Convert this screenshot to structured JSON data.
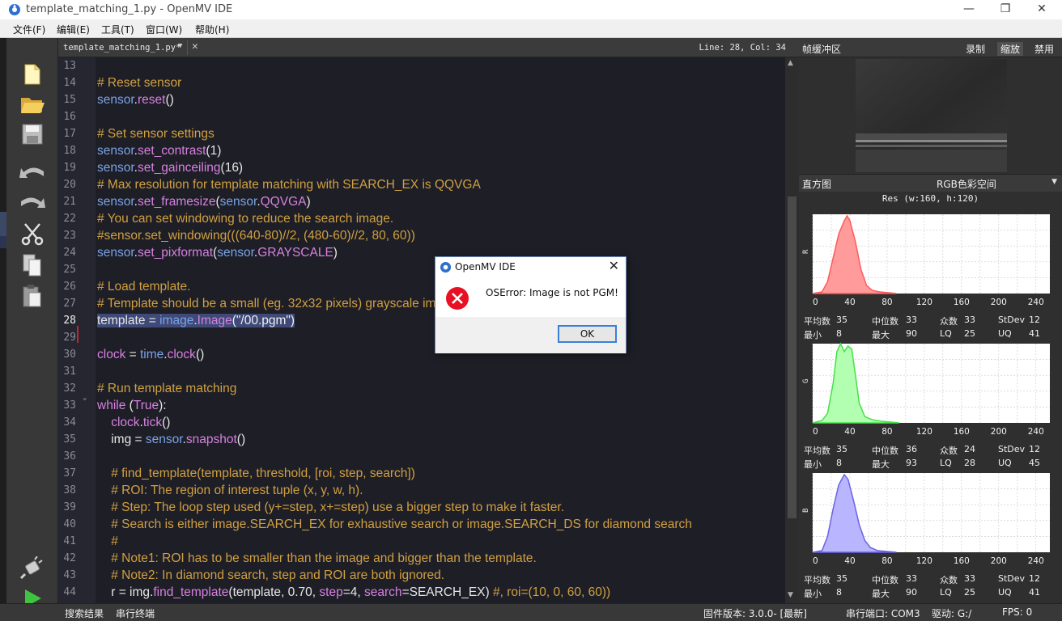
{
  "window": {
    "title": "template_matching_1.py - OpenMV IDE",
    "minimize": "—",
    "restore": "❐",
    "close": "✕"
  },
  "menu": [
    "文件(F)",
    "编辑(E)",
    "工具(T)",
    "窗口(W)",
    "帮助(H)"
  ],
  "editor": {
    "tab_name": "template_matching_1.py*",
    "cursor_pos": "Line: 28, Col: 34",
    "current_line": 28,
    "lines": [
      {
        "n": 13,
        "segs": []
      },
      {
        "n": 14,
        "segs": [
          {
            "c": "cm",
            "t": "# Reset sensor"
          }
        ]
      },
      {
        "n": 15,
        "segs": [
          {
            "c": "mod",
            "t": "sensor"
          },
          {
            "c": "tx",
            "t": "."
          },
          {
            "c": "fn",
            "t": "reset"
          },
          {
            "c": "tx",
            "t": "()"
          }
        ]
      },
      {
        "n": 16,
        "segs": []
      },
      {
        "n": 17,
        "segs": [
          {
            "c": "cm",
            "t": "# Set sensor settings"
          }
        ]
      },
      {
        "n": 18,
        "segs": [
          {
            "c": "mod",
            "t": "sensor"
          },
          {
            "c": "tx",
            "t": "."
          },
          {
            "c": "fn",
            "t": "set_contrast"
          },
          {
            "c": "tx",
            "t": "(1)"
          }
        ]
      },
      {
        "n": 19,
        "segs": [
          {
            "c": "mod",
            "t": "sensor"
          },
          {
            "c": "tx",
            "t": "."
          },
          {
            "c": "fn",
            "t": "set_gainceiling"
          },
          {
            "c": "tx",
            "t": "(16)"
          }
        ]
      },
      {
        "n": 20,
        "segs": [
          {
            "c": "cm",
            "t": "# Max resolution for template matching with SEARCH_EX is QQVGA"
          }
        ]
      },
      {
        "n": 21,
        "segs": [
          {
            "c": "mod",
            "t": "sensor"
          },
          {
            "c": "tx",
            "t": "."
          },
          {
            "c": "fn",
            "t": "set_framesize"
          },
          {
            "c": "tx",
            "t": "("
          },
          {
            "c": "mod",
            "t": "sensor"
          },
          {
            "c": "tx",
            "t": "."
          },
          {
            "c": "fn",
            "t": "QQVGA"
          },
          {
            "c": "tx",
            "t": ")"
          }
        ]
      },
      {
        "n": 22,
        "segs": [
          {
            "c": "cm",
            "t": "# You can set windowing to reduce the search image."
          }
        ]
      },
      {
        "n": 23,
        "segs": [
          {
            "c": "cm",
            "t": "#sensor.set_windowing(((640-80)//2, (480-60)//2, 80, 60))"
          }
        ]
      },
      {
        "n": 24,
        "segs": [
          {
            "c": "mod",
            "t": "sensor"
          },
          {
            "c": "tx",
            "t": "."
          },
          {
            "c": "fn",
            "t": "set_pixformat"
          },
          {
            "c": "tx",
            "t": "("
          },
          {
            "c": "mod",
            "t": "sensor"
          },
          {
            "c": "tx",
            "t": "."
          },
          {
            "c": "fn",
            "t": "GRAYSCALE"
          },
          {
            "c": "tx",
            "t": ")"
          }
        ]
      },
      {
        "n": 25,
        "segs": []
      },
      {
        "n": 26,
        "segs": [
          {
            "c": "cm",
            "t": "# Load template."
          }
        ]
      },
      {
        "n": 27,
        "segs": [
          {
            "c": "cm",
            "t": "# Template should be a small (eg. 32x32 pixels) grayscale image."
          }
        ]
      },
      {
        "n": 28,
        "hl": true,
        "segs": [
          {
            "c": "tx",
            "t": "template = "
          },
          {
            "c": "mod",
            "t": "image"
          },
          {
            "c": "tx",
            "t": "."
          },
          {
            "c": "fn",
            "t": "Image"
          },
          {
            "c": "str",
            "t": "(\"/00.pgm\")"
          }
        ]
      },
      {
        "n": 29,
        "segs": []
      },
      {
        "n": 30,
        "segs": [
          {
            "c": "fn",
            "t": "clock"
          },
          {
            "c": "tx",
            "t": " = "
          },
          {
            "c": "mod",
            "t": "time"
          },
          {
            "c": "tx",
            "t": "."
          },
          {
            "c": "fn",
            "t": "clock"
          },
          {
            "c": "tx",
            "t": "()"
          }
        ]
      },
      {
        "n": 31,
        "segs": []
      },
      {
        "n": 32,
        "segs": [
          {
            "c": "cm",
            "t": "# Run template matching"
          }
        ]
      },
      {
        "n": 33,
        "segs": [
          {
            "c": "kw",
            "t": "while"
          },
          {
            "c": "tx",
            "t": " ("
          },
          {
            "c": "kw",
            "t": "True"
          },
          {
            "c": "tx",
            "t": "):"
          }
        ]
      },
      {
        "n": 34,
        "segs": [
          {
            "c": "tx",
            "t": "    "
          },
          {
            "c": "fn",
            "t": "clock"
          },
          {
            "c": "tx",
            "t": "."
          },
          {
            "c": "fn",
            "t": "tick"
          },
          {
            "c": "tx",
            "t": "()"
          }
        ]
      },
      {
        "n": 35,
        "segs": [
          {
            "c": "tx",
            "t": "    img = "
          },
          {
            "c": "mod",
            "t": "sensor"
          },
          {
            "c": "tx",
            "t": "."
          },
          {
            "c": "fn",
            "t": "snapshot"
          },
          {
            "c": "tx",
            "t": "()"
          }
        ]
      },
      {
        "n": 36,
        "segs": []
      },
      {
        "n": 37,
        "segs": [
          {
            "c": "cm",
            "t": "    # find_template(template, threshold, [roi, step, search])"
          }
        ]
      },
      {
        "n": 38,
        "segs": [
          {
            "c": "cm",
            "t": "    # ROI: The region of interest tuple (x, y, w, h)."
          }
        ]
      },
      {
        "n": 39,
        "segs": [
          {
            "c": "cm",
            "t": "    # Step: The loop step used (y+=step, x+=step) use a bigger step to make it faster."
          }
        ]
      },
      {
        "n": 40,
        "segs": [
          {
            "c": "cm",
            "t": "    # Search is either image.SEARCH_EX for exhaustive search or image.SEARCH_DS for diamond search"
          }
        ]
      },
      {
        "n": 41,
        "segs": [
          {
            "c": "cm",
            "t": "    #"
          }
        ]
      },
      {
        "n": 42,
        "segs": [
          {
            "c": "cm",
            "t": "    # Note1: ROI has to be smaller than the image and bigger than the template."
          }
        ]
      },
      {
        "n": 43,
        "segs": [
          {
            "c": "cm",
            "t": "    # Note2: In diamond search, step and ROI are both ignored."
          }
        ]
      },
      {
        "n": 44,
        "segs": [
          {
            "c": "tx",
            "t": "    r = img."
          },
          {
            "c": "fn",
            "t": "find_template"
          },
          {
            "c": "tx",
            "t": "(template, 0.70, "
          },
          {
            "c": "fn",
            "t": "step"
          },
          {
            "c": "tx",
            "t": "=4, "
          },
          {
            "c": "fn",
            "t": "search"
          },
          {
            "c": "tx",
            "t": "=SEARCH_EX) "
          },
          {
            "c": "cm",
            "t": "#, roi=(10, 0, 60, 60))"
          }
        ]
      }
    ]
  },
  "frame_buffer": {
    "label": "帧缓冲区",
    "record": "录制",
    "zoom": "缩放",
    "disable": "禁用"
  },
  "histogram": {
    "label": "直方图",
    "color_space": "RGB色彩空间",
    "resolution": "Res (w:160, h:120)",
    "x_ticks": [
      "0",
      "40",
      "80",
      "120",
      "160",
      "200",
      "240"
    ],
    "channels": [
      {
        "axis": "R",
        "color": "#ff9b9b",
        "stroke": "#ff5a5a",
        "profile": [
          [
            0,
            0
          ],
          [
            10,
            0.02
          ],
          [
            16,
            0.15
          ],
          [
            22,
            0.45
          ],
          [
            28,
            0.75
          ],
          [
            34,
            0.92
          ],
          [
            37,
            0.98
          ],
          [
            40,
            0.92
          ],
          [
            46,
            0.65
          ],
          [
            52,
            0.3
          ],
          [
            58,
            0.1
          ],
          [
            64,
            0.04
          ],
          [
            72,
            0.02
          ],
          [
            82,
            0.01
          ],
          [
            90,
            0
          ]
        ],
        "stats": {
          "mean_l": "平均数",
          "mean": "35",
          "median_l": "中位数",
          "median": "33",
          "mode_l": "众数",
          "mode": "33",
          "stdev_l": "StDev",
          "stdev": "12",
          "min_l": "最小",
          "min": "8",
          "max_l": "最大",
          "max": "90",
          "lq_l": "LQ",
          "lq": "25",
          "uq_l": "UQ",
          "uq": "41"
        }
      },
      {
        "axis": "G",
        "color": "#b2ffb2",
        "stroke": "#46e046",
        "profile": [
          [
            0,
            0
          ],
          [
            10,
            0.03
          ],
          [
            16,
            0.12
          ],
          [
            22,
            0.5
          ],
          [
            26,
            0.9
          ],
          [
            30,
            1.0
          ],
          [
            34,
            0.9
          ],
          [
            38,
            0.97
          ],
          [
            42,
            0.93
          ],
          [
            46,
            0.6
          ],
          [
            50,
            0.25
          ],
          [
            56,
            0.08
          ],
          [
            64,
            0.04
          ],
          [
            74,
            0.02
          ],
          [
            84,
            0.01
          ],
          [
            93,
            0
          ]
        ],
        "stats": {
          "mean_l": "平均数",
          "mean": "35",
          "median_l": "中位数",
          "median": "36",
          "mode_l": "众数",
          "mode": "24",
          "stdev_l": "StDev",
          "stdev": "12",
          "min_l": "最小",
          "min": "8",
          "max_l": "最大",
          "max": "93",
          "lq_l": "LQ",
          "lq": "28",
          "uq_l": "UQ",
          "uq": "45"
        }
      },
      {
        "axis": "B",
        "color": "#b9b5ff",
        "stroke": "#6a62e6",
        "profile": [
          [
            0,
            0
          ],
          [
            10,
            0.02
          ],
          [
            16,
            0.2
          ],
          [
            22,
            0.55
          ],
          [
            28,
            0.85
          ],
          [
            34,
            0.98
          ],
          [
            38,
            0.92
          ],
          [
            44,
            0.65
          ],
          [
            50,
            0.35
          ],
          [
            56,
            0.15
          ],
          [
            62,
            0.06
          ],
          [
            70,
            0.02
          ],
          [
            80,
            0.01
          ],
          [
            90,
            0
          ]
        ],
        "stats": {
          "mean_l": "平均数",
          "mean": "35",
          "median_l": "中位数",
          "median": "33",
          "mode_l": "众数",
          "mode": "33",
          "stdev_l": "StDev",
          "stdev": "12",
          "min_l": "最小",
          "min": "8",
          "max_l": "最大",
          "max": "90",
          "lq_l": "LQ",
          "lq": "25",
          "uq_l": "UQ",
          "uq": "41"
        }
      }
    ]
  },
  "dialog": {
    "title": "OpenMV IDE",
    "message": "OSError: Image is not PGM!",
    "ok": "OK"
  },
  "status": {
    "search_results": "搜索结果",
    "serial_terminal": "串行终端",
    "firmware": "固件版本: 3.0.0- [最新]",
    "serial_port": "串行端口: COM3",
    "drive": "驱动: G:/",
    "fps": "FPS: 0"
  }
}
